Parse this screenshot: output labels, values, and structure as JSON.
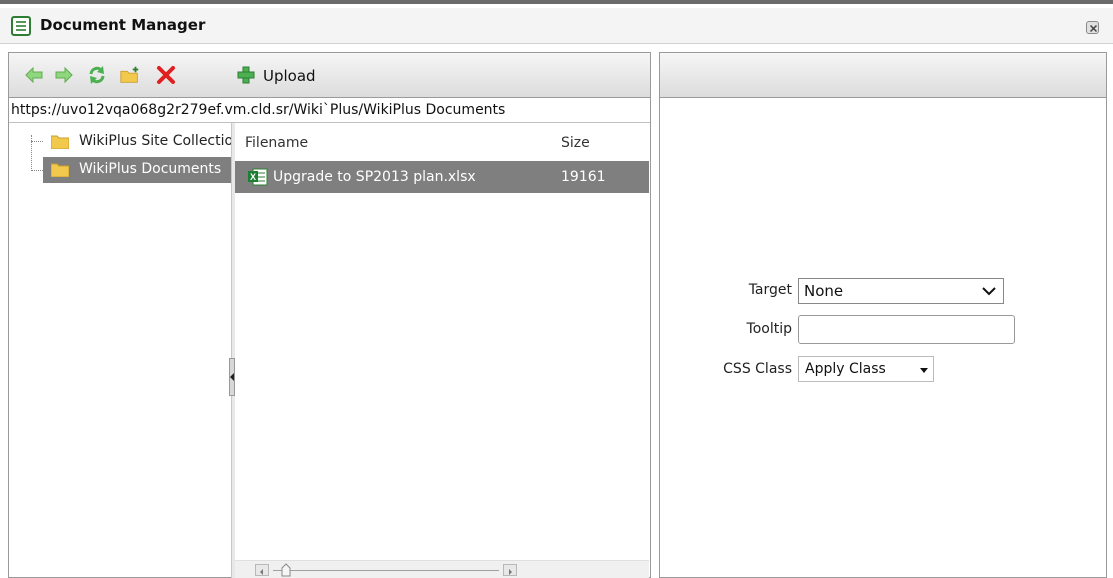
{
  "window": {
    "title": "Document Manager"
  },
  "toolbar": {
    "upload_label": "Upload",
    "icons": [
      "back-arrow-icon",
      "forward-arrow-icon",
      "refresh-icon",
      "new-folder-icon",
      "delete-icon",
      "upload-plus-icon"
    ]
  },
  "path": "https://uvo12vqa068g2r279ef.vm.cld.sr/Wiki`Plus/WikiPlus Documents",
  "tree": {
    "items": [
      {
        "label": "WikiPlus Site Collection",
        "selected": false
      },
      {
        "label": "WikiPlus Documents",
        "selected": true
      }
    ]
  },
  "filelist": {
    "columns": [
      "Filename",
      "Size"
    ],
    "rows": [
      {
        "filename": "Upgrade to SP2013 plan.xlsx",
        "size": "19161",
        "selected": true
      }
    ]
  },
  "properties": {
    "target_label": "Target",
    "target_value": "None",
    "tooltip_label": "Tooltip",
    "tooltip_value": "",
    "css_label": "CSS Class",
    "css_value": "Apply Class"
  },
  "colors": {
    "selection": "#7f7f7f",
    "delete_red": "#e02020",
    "arrow_green": "#6fcf5f",
    "folder_yellow": "#f2c94c"
  }
}
